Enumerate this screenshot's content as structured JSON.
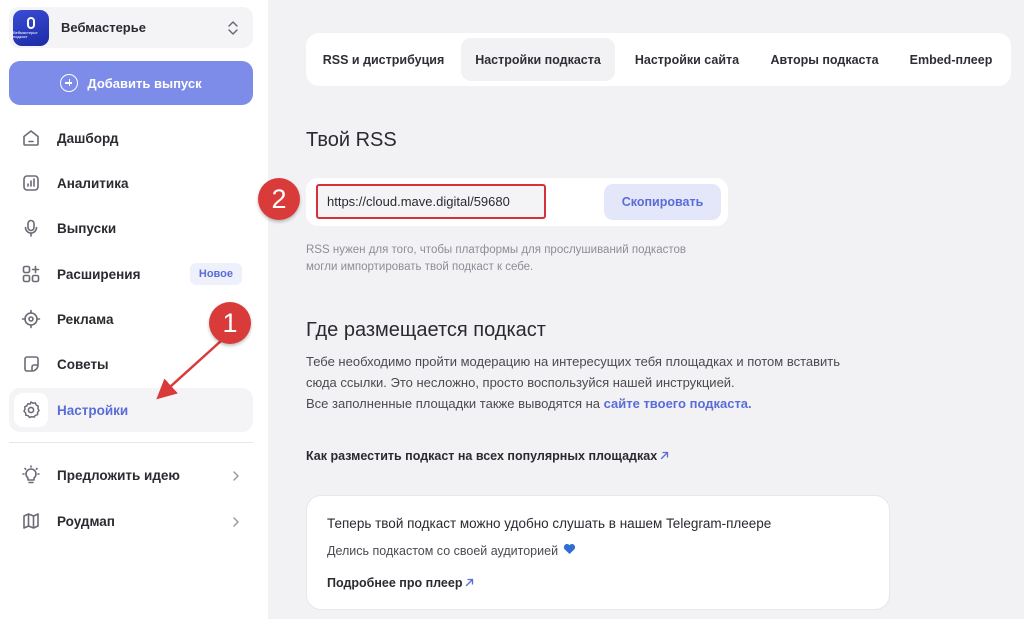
{
  "sidebar": {
    "podcast": {
      "name": "Вебмастерье",
      "logo_caption": "Вебмастерье подкаст"
    },
    "add_button": "Добавить выпуск",
    "nav": [
      {
        "label": "Дашборд",
        "icon": "home-icon"
      },
      {
        "label": "Аналитика",
        "icon": "analytics-icon"
      },
      {
        "label": "Выпуски",
        "icon": "microphone-icon"
      },
      {
        "label": "Расширения",
        "icon": "extensions-icon",
        "badge": "Новое"
      },
      {
        "label": "Реклама",
        "icon": "target-icon"
      },
      {
        "label": "Советы",
        "icon": "tips-icon"
      },
      {
        "label": "Настройки",
        "icon": "gear-icon",
        "active": true
      }
    ],
    "bottom": [
      {
        "label": "Предложить идею",
        "icon": "lightbulb-icon"
      },
      {
        "label": "Роудмап",
        "icon": "map-icon"
      }
    ]
  },
  "tabs": [
    {
      "label": "RSS и дистрибуция"
    },
    {
      "label": "Настройки подкаста",
      "active": true
    },
    {
      "label": "Настройки сайта"
    },
    {
      "label": "Авторы подкаста"
    },
    {
      "label": "Embed-плеер"
    }
  ],
  "rss": {
    "title": "Твой RSS",
    "url": "https://cloud.mave.digital/59680",
    "copy_button": "Скопировать",
    "hint": "RSS нужен для того, чтобы платформы для прослушиваний подкастов могли импортировать твой подкаст к себе."
  },
  "placement": {
    "title": "Где размещается подкаст",
    "text_1": "Тебе необходимо пройти модерацию на интересущих тебя площадках и потом вставить сюда ссылки. Это несложно, просто воспользуйся нашей инструкцией.",
    "text_2_prefix": "Все заполненные площадки также выводятся на ",
    "text_2_link": "сайте твоего подкаста.",
    "howto_link": "Как разместить подкаст на всех популярных площадках"
  },
  "telegram_card": {
    "title": "Теперь твой подкаст можно удобно слушать в нашем Telegram-плеере",
    "subtitle": "Делись подкастом со своей аудиторией",
    "more_link": "Подробнее про плеер"
  },
  "annotations": {
    "marker_1": "1",
    "marker_2": "2",
    "color": "#d93b3b"
  },
  "colors": {
    "accent": "#5a6cd7",
    "add_button": "#7d8ce9",
    "highlight": "#d4313b"
  }
}
